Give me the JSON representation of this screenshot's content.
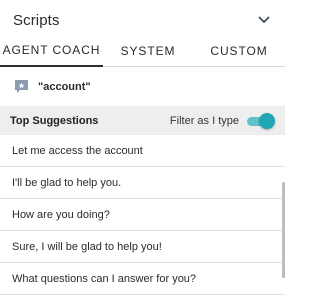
{
  "header": {
    "title": "Scripts"
  },
  "tabs": [
    {
      "label": "AGENT COACH"
    },
    {
      "label": "SYSTEM"
    },
    {
      "label": "CUSTOM"
    }
  ],
  "query": {
    "text": "\"account\""
  },
  "suggestions": {
    "title": "Top Suggestions",
    "filter_label": "Filter as I type",
    "filter_on": true,
    "items": [
      "Let me access the account",
      "I'll be glad to help you.",
      "How are you doing?",
      "Sure, I will be glad to help you!",
      "What questions can I answer for you?"
    ]
  },
  "colors": {
    "accent": "#1ea7b3",
    "header_bg": "#eeeeee"
  }
}
